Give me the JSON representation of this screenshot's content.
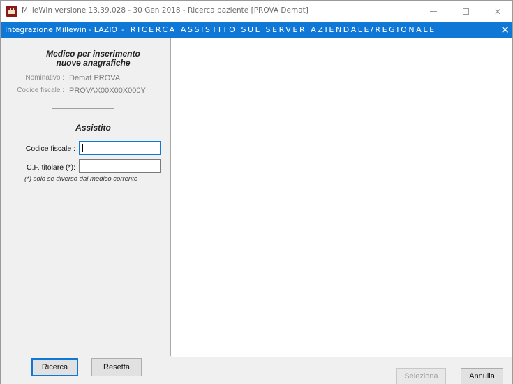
{
  "window": {
    "title": "MilleWin versione 13.39.028 - 30 Gen 2018 - Ricerca paziente [PROVA Demat]",
    "icon": "app-castle-icon"
  },
  "header": {
    "title": "Integrazione Millewin - LAZIO",
    "subtitle": "-   RICERCA ASSISTITO SUL SERVER AZIENDALE/REGIONALE",
    "close": "✕"
  },
  "medico": {
    "title_line1": "Medico per inserimento",
    "title_line2": "nuove anagrafiche",
    "nominativo_label": "Nominativo :",
    "nominativo_value": "Demat PROVA",
    "cf_label": "Codice fiscale :",
    "cf_value": "PROVAX00X00X000Y"
  },
  "assistito": {
    "title": "Assistito",
    "cf_label": "Codice fiscale :",
    "cf_value": "",
    "titolare_label": "C.F. titolare (*):",
    "titolare_value": "",
    "hint": "(*) solo se diverso dal medico corrente"
  },
  "buttons": {
    "ricerca": "Ricerca",
    "resetta": "Resetta",
    "seleziona": "Seleziona",
    "annulla": "Annulla"
  },
  "colors": {
    "accent": "#0f78d7",
    "panel": "#f0f0f0"
  }
}
